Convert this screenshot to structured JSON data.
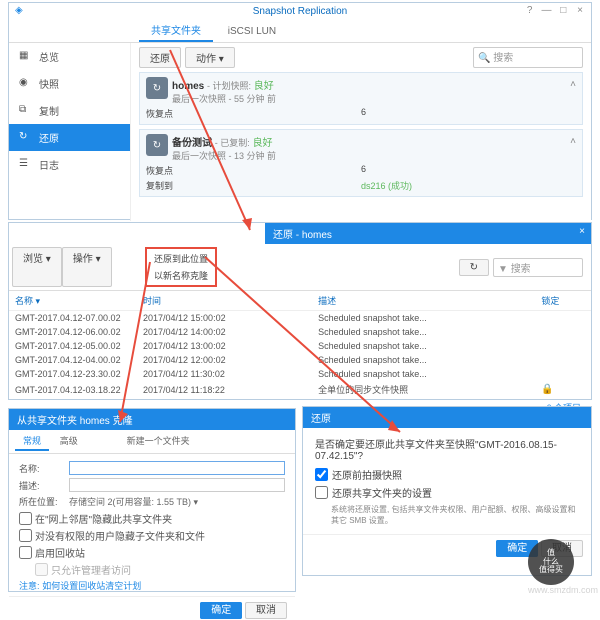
{
  "main": {
    "title": "Snapshot Replication",
    "tabs": [
      "共享文件夹",
      "iSCSI LUN"
    ],
    "sidebar": [
      {
        "icon": "overview",
        "label": "总览"
      },
      {
        "icon": "snapshot",
        "label": "快照"
      },
      {
        "icon": "replicate",
        "label": "复制"
      },
      {
        "icon": "restore",
        "label": "还原"
      },
      {
        "icon": "log",
        "label": "日志"
      }
    ],
    "toolbar": {
      "btn1": "还原",
      "btn2": "动作 ▾",
      "search": "搜索"
    },
    "cards": [
      {
        "title": "homes",
        "status": "- 计划快照:",
        "status2": "良好",
        "sub": "最后一次快照 - 55 分钟 前",
        "k1": "恢复点",
        "v1": "6"
      },
      {
        "title": "备份测试",
        "status": "- 已复制:",
        "status2": "良好",
        "sub": "最后一次快照 - 13 分钟 前",
        "k1": "恢复点",
        "v1": "6",
        "k2": "复制到",
        "v2": "ds216 (成功)"
      }
    ]
  },
  "panel2": {
    "title": "还原 - homes",
    "leftbtns": [
      "浏览 ▾",
      "操作 ▾"
    ],
    "menu": [
      "还原到此位置",
      "以新名称克隆"
    ],
    "refresh": "↻",
    "filter": "搜索",
    "cols": [
      "名称 ▾",
      "时间",
      "描述",
      "锁定"
    ],
    "rows": [
      {
        "n": "GMT-2017.04.12-07.00.02",
        "t": "2017/04/12 15:00:02",
        "d": "Scheduled snapshot take..."
      },
      {
        "n": "GMT-2017.04.12-06.00.02",
        "t": "2017/04/12 14:00:02",
        "d": "Scheduled snapshot take..."
      },
      {
        "n": "GMT-2017.04.12-05.00.02",
        "t": "2017/04/12 13:00:02",
        "d": "Scheduled snapshot take..."
      },
      {
        "n": "GMT-2017.04.12-04.00.02",
        "t": "2017/04/12 12:00:02",
        "d": "Scheduled snapshot take..."
      },
      {
        "n": "GMT-2017.04.12-23.30.02",
        "t": "2017/04/12 11:30:02",
        "d": "Scheduled snapshot take..."
      },
      {
        "n": "GMT-2017.04.12-03.18.22",
        "t": "2017/04/12 11:18:22",
        "d": "全单位的同步文件快照",
        "lock": true
      }
    ],
    "footer": "6 个项目"
  },
  "dlg1": {
    "title": "从共享文件夹 homes 克隆",
    "tabs": [
      "常规",
      "高级"
    ],
    "hint": "新建一个文件夹",
    "name_l": "名称:",
    "desc_l": "描述:",
    "loc_l": "所在位置:",
    "loc_v": "存储空间 2(可用容量: 1.55 TB) ▾",
    "c1": "在\"网上邻居\"隐藏此共享文件夹",
    "c2": "对没有权限的用户隐藏子文件夹和文件",
    "c3": "启用回收站",
    "c4": "只允许管理者访问",
    "note_l": "注意:",
    "note": "如何设置回收站清空计划",
    "ok": "确定",
    "cancel": "取消"
  },
  "dlg2": {
    "title": "还原",
    "msg": "是否确定要还原此共享文件夹至快照\"GMT-2016.08.15-07.42.15\"?",
    "c1": "还原前拍摄快照",
    "c2": "还原共享文件夹的设置",
    "note": "系统将还原设置, 包括共享文件夹权限、用户配额、权限、高级设置和其它 SMB 设置。",
    "ok": "确定",
    "cancel": "取消"
  },
  "watermark": {
    "txt": "值\n什么值得买",
    "url": "www.smzdm.com"
  }
}
